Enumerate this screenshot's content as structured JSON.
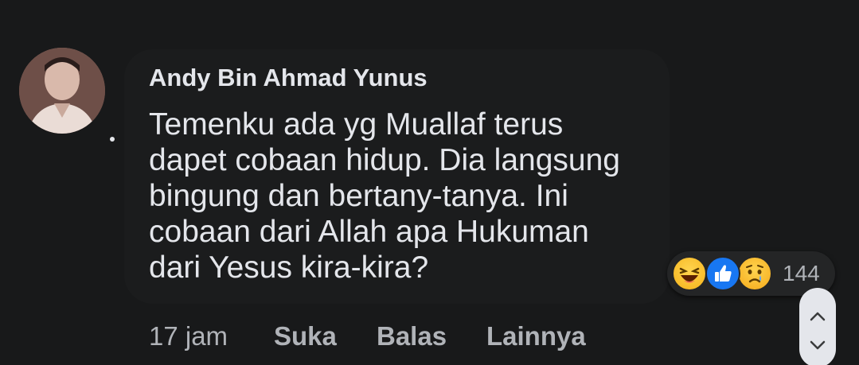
{
  "comment": {
    "author": "Andy Bin Ahmad Yunus",
    "text_lines": [
      "Temenku ada yg Muallaf terus",
      "dapet cobaan hidup. Dia langsung",
      "bingung dan bertany-tanya. Ini",
      "cobaan dari Allah apa Hukuman",
      "dari Yesus kira-kira?"
    ],
    "reactions": {
      "icons": [
        "haha-icon",
        "like-icon",
        "sad-icon"
      ],
      "count": "144"
    },
    "time": "17 jam",
    "actions": {
      "like": "Suka",
      "reply": "Balas",
      "more": "Lainnya"
    }
  },
  "colors": {
    "background": "#18191a",
    "bubble": "#1b1c1d",
    "text_primary": "#e4e6eb",
    "text_secondary": "#b0b3b8",
    "like_blue": "#1877f2",
    "emoji_yellow": "#f5b21a"
  },
  "scroll_controls": {
    "up_icon": "chevron-up-icon",
    "down_icon": "chevron-down-icon"
  }
}
